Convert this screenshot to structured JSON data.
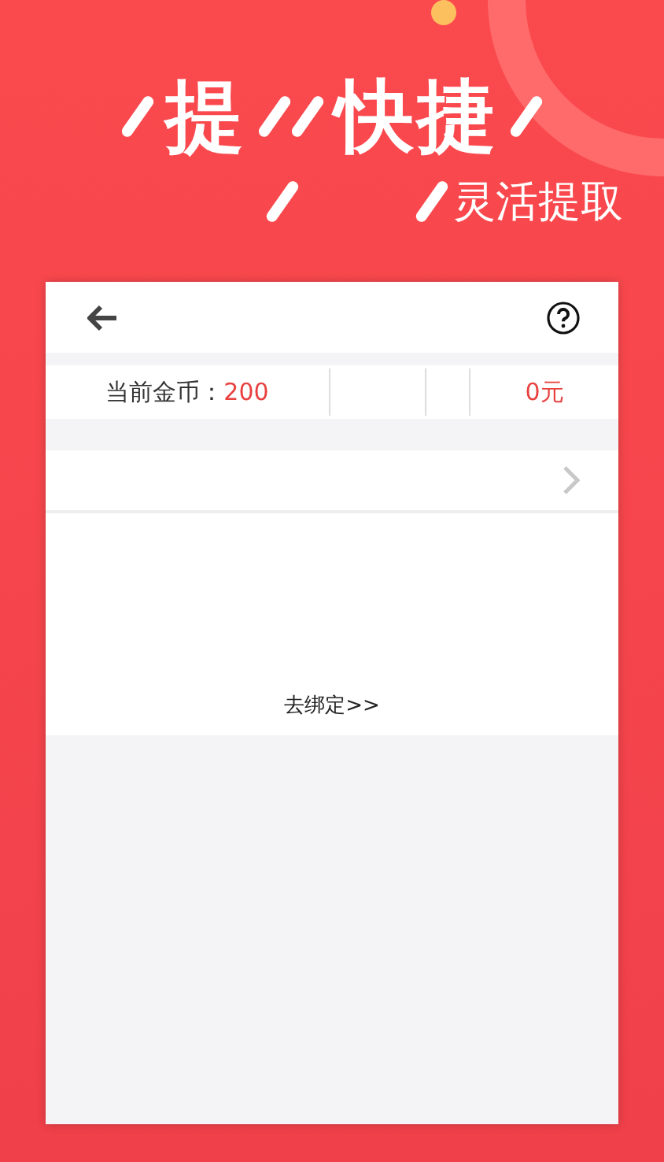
{
  "headline": {
    "words": [
      "提",
      "快捷"
    ],
    "subtitle": "灵活提取"
  },
  "panel": {
    "coins_label": "当前金币：",
    "coins_value": "200",
    "cash_value": "0元",
    "bind_link": "去绑定>>"
  }
}
